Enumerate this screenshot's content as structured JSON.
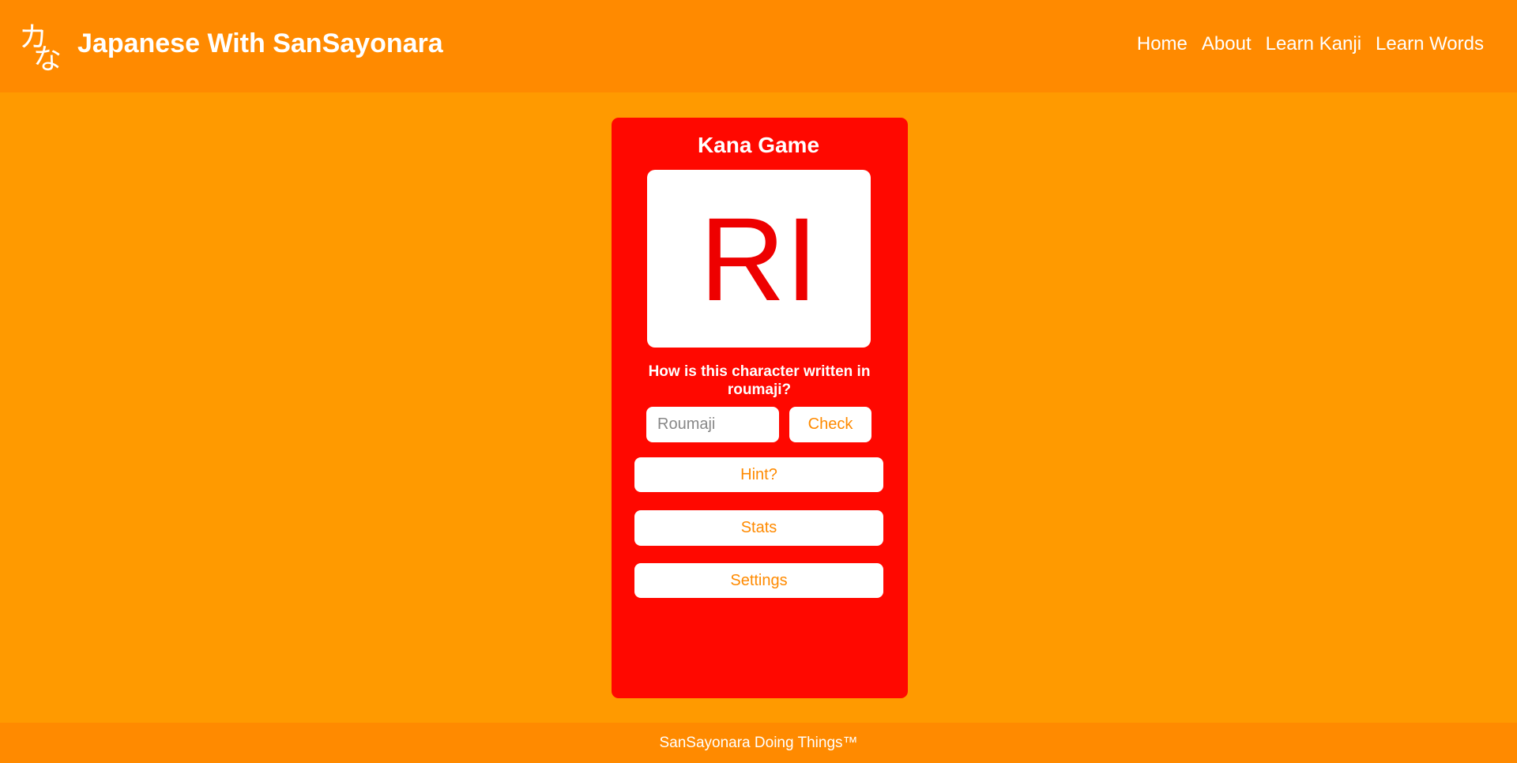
{
  "header": {
    "logo_glyphs": [
      "カ",
      "な"
    ],
    "title": "Japanese With SanSayonara",
    "nav": [
      "Home",
      "About",
      "Learn Kanji",
      "Learn Words"
    ]
  },
  "game": {
    "title": "Kana Game",
    "character": "RI",
    "question": "How is this character written in roumaji?",
    "input_placeholder": "Roumaji",
    "input_value": "",
    "check_label": "Check",
    "hint_label": "Hint?",
    "stats_label": "Stats",
    "settings_label": "Settings"
  },
  "footer": {
    "text": "SanSayonara Doing Things™"
  },
  "colors": {
    "header": "#ff8a00",
    "background": "#ff9a00",
    "card": "#ff0800",
    "accent_text": "#ff8a00"
  }
}
